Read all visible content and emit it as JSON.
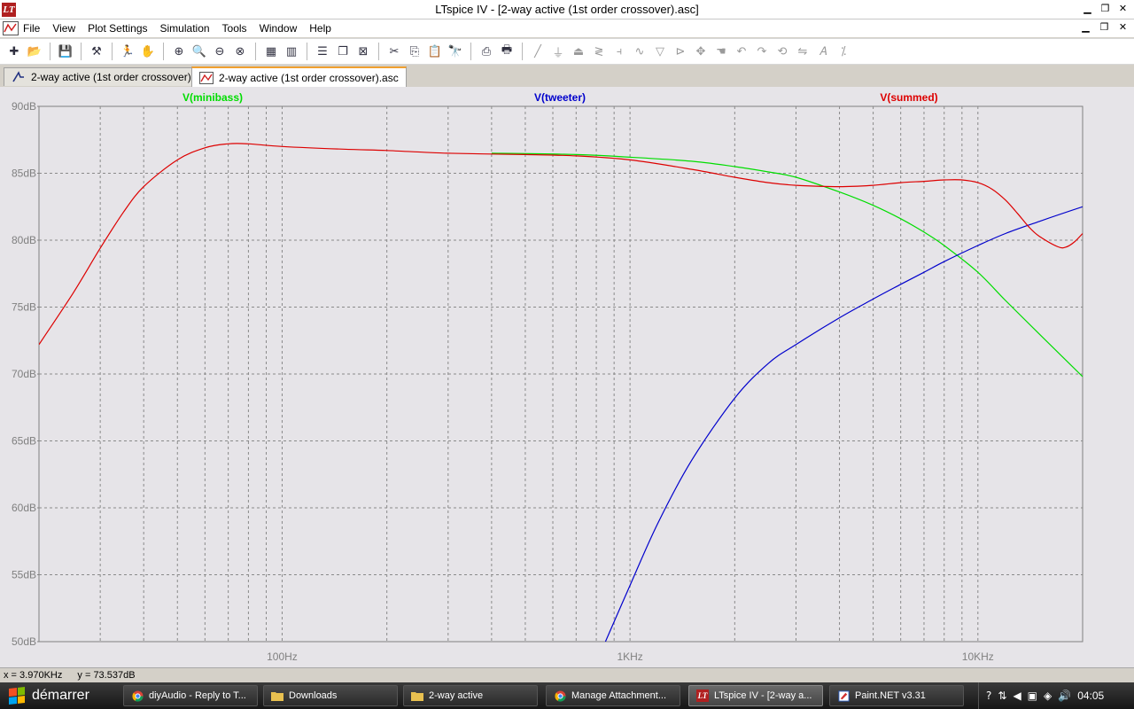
{
  "window": {
    "title": "LTspice IV - [2-way active (1st order crossover).asc]",
    "minimize_glyph": "▁",
    "maximize_glyph": "❐",
    "close_glyph": "✕"
  },
  "menu": {
    "items": [
      "File",
      "View",
      "Plot Settings",
      "Simulation",
      "Tools",
      "Window",
      "Help"
    ]
  },
  "tabs": [
    {
      "label": "2-way active (1st order crossover).asc",
      "icon": "schematic-icon",
      "active": false
    },
    {
      "label": "2-way active (1st order crossover).asc",
      "icon": "waveform-icon",
      "active": true
    }
  ],
  "chart_data": {
    "type": "line",
    "xscale": "log",
    "xlim": [
      20,
      20000
    ],
    "ylim": [
      50,
      90
    ],
    "grid": true,
    "x_ticks": [
      {
        "value": 100,
        "label": "100Hz"
      },
      {
        "value": 1000,
        "label": "1KHz"
      },
      {
        "value": 10000,
        "label": "10KHz"
      }
    ],
    "y_ticks": [
      {
        "value": 90,
        "label": "90dB"
      },
      {
        "value": 85,
        "label": "85dB"
      },
      {
        "value": 80,
        "label": "80dB"
      },
      {
        "value": 75,
        "label": "75dB"
      },
      {
        "value": 70,
        "label": "70dB"
      },
      {
        "value": 65,
        "label": "65dB"
      },
      {
        "value": 60,
        "label": "60dB"
      },
      {
        "value": 55,
        "label": "55dB"
      },
      {
        "value": 50,
        "label": "50dB"
      }
    ],
    "legend": "top",
    "series": [
      {
        "name": "V(minibass)",
        "color": "#00dd00",
        "x": [
          400,
          700,
          1000,
          1500,
          2000,
          2500,
          3000,
          4000,
          5000,
          6000,
          7000,
          8000,
          10000,
          12000,
          15000,
          20000
        ],
        "y": [
          86.5,
          86.4,
          86.2,
          85.9,
          85.5,
          85.1,
          84.7,
          83.6,
          82.6,
          81.6,
          80.6,
          79.6,
          77.6,
          75.5,
          73.0,
          69.8
        ]
      },
      {
        "name": "V(tweeter)",
        "color": "#0000cc",
        "x": [
          850,
          1000,
          1200,
          1500,
          2000,
          2500,
          3000,
          4000,
          5000,
          6000,
          7000,
          8000,
          10000,
          12000,
          15000,
          20000
        ],
        "y": [
          50.0,
          54.2,
          58.8,
          63.5,
          68.2,
          70.8,
          72.2,
          74.2,
          75.6,
          76.7,
          77.6,
          78.4,
          79.6,
          80.5,
          81.4,
          82.5
        ]
      },
      {
        "name": "V(summed)",
        "color": "#dd0000",
        "x": [
          20,
          25,
          30,
          35,
          40,
          50,
          60,
          70,
          80,
          100,
          150,
          200,
          300,
          500,
          700,
          1000,
          1500,
          2000,
          2500,
          3000,
          4000,
          5000,
          6000,
          7000,
          8000,
          9000,
          10000,
          11000,
          12000,
          13000,
          14000,
          15000,
          17000,
          18000,
          19000,
          20000
        ],
        "y": [
          72.2,
          76.0,
          79.4,
          82.1,
          84.0,
          86.0,
          86.9,
          87.2,
          87.2,
          87.0,
          86.8,
          86.7,
          86.5,
          86.4,
          86.3,
          86.0,
          85.3,
          84.7,
          84.3,
          84.1,
          84.0,
          84.1,
          84.3,
          84.4,
          84.5,
          84.5,
          84.3,
          83.8,
          83.0,
          82.0,
          81.0,
          80.3,
          79.5,
          79.5,
          79.9,
          80.5
        ]
      }
    ]
  },
  "status": {
    "x_readout": "x = 3.970KHz",
    "y_readout": "y = 73.537dB"
  },
  "taskbar": {
    "start_label": "démarrer",
    "tasks": [
      {
        "label": "diyAudio - Reply to T...",
        "icon": "chrome-icon",
        "active": false
      },
      {
        "label": "Downloads",
        "icon": "folder-icon",
        "active": false
      },
      {
        "label": "2-way active",
        "icon": "folder-icon",
        "active": false
      },
      {
        "label": "Manage Attachment...",
        "icon": "chrome-icon",
        "active": false
      },
      {
        "label": "LTspice IV - [2-way a...",
        "icon": "ltspice-icon",
        "active": true
      },
      {
        "label": "Paint.NET v3.31",
        "icon": "paintnet-icon",
        "active": false
      }
    ],
    "clock": "04:05"
  }
}
